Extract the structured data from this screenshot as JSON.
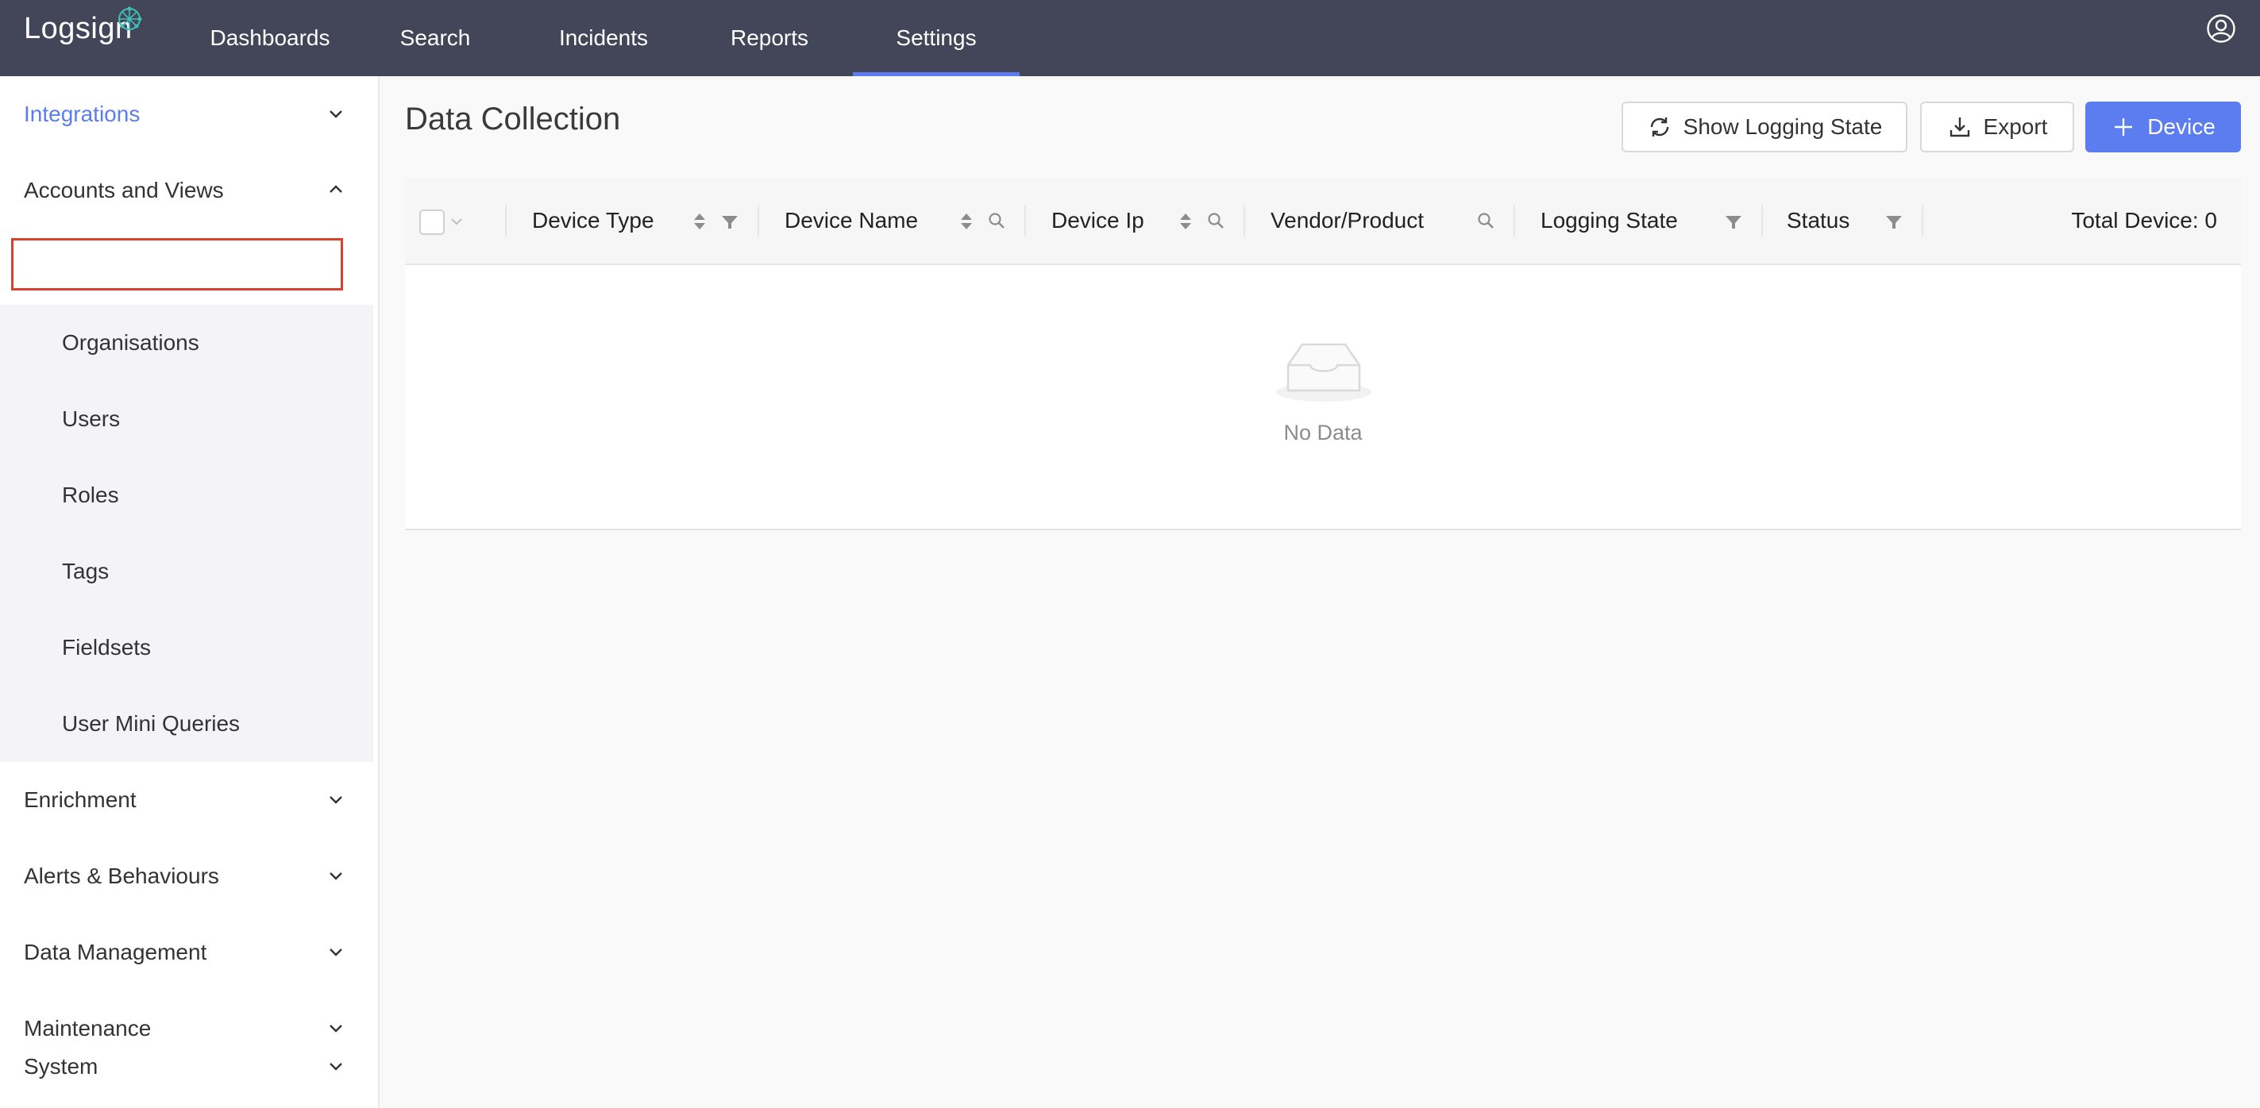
{
  "topbar": {
    "logo_text": "Logsign",
    "nav": [
      {
        "label": "Dashboards"
      },
      {
        "label": "Search"
      },
      {
        "label": "Incidents"
      },
      {
        "label": "Reports"
      },
      {
        "label": "Settings",
        "active": true
      }
    ]
  },
  "sidebar": {
    "sections": [
      {
        "label": "Integrations",
        "expanded": false,
        "active": true
      },
      {
        "label": "Accounts and Views",
        "expanded": true
      },
      {
        "label": "Enrichment",
        "expanded": false
      },
      {
        "label": "Alerts & Behaviours",
        "expanded": false
      },
      {
        "label": "Data Management",
        "expanded": false
      },
      {
        "label": "Maintenance",
        "expanded": false
      },
      {
        "label": "System",
        "expanded": false
      }
    ],
    "accounts_items": [
      {
        "label": "Organisations",
        "highlighted": true
      },
      {
        "label": "Users"
      },
      {
        "label": "Roles"
      },
      {
        "label": "Tags"
      },
      {
        "label": "Fieldsets"
      },
      {
        "label": "User Mini Queries"
      }
    ]
  },
  "main": {
    "title": "Data Collection",
    "buttons": {
      "show_logging_state": "Show Logging State",
      "export": "Export",
      "device": "Device"
    },
    "table": {
      "columns": [
        {
          "label": "Device Type",
          "sort": true,
          "filter": true
        },
        {
          "label": "Device Name",
          "sort": true,
          "search": true
        },
        {
          "label": "Device Ip",
          "sort": true,
          "search": true
        },
        {
          "label": "Vendor/Product",
          "search": true
        },
        {
          "label": "Logging State",
          "filter": true
        },
        {
          "label": "Status",
          "filter": true
        }
      ],
      "total_label": "Total Device: 0",
      "empty_text": "No Data"
    }
  },
  "colors": {
    "topbar": "#434658",
    "accent": "#5b7df0",
    "highlight": "#d9412f"
  }
}
